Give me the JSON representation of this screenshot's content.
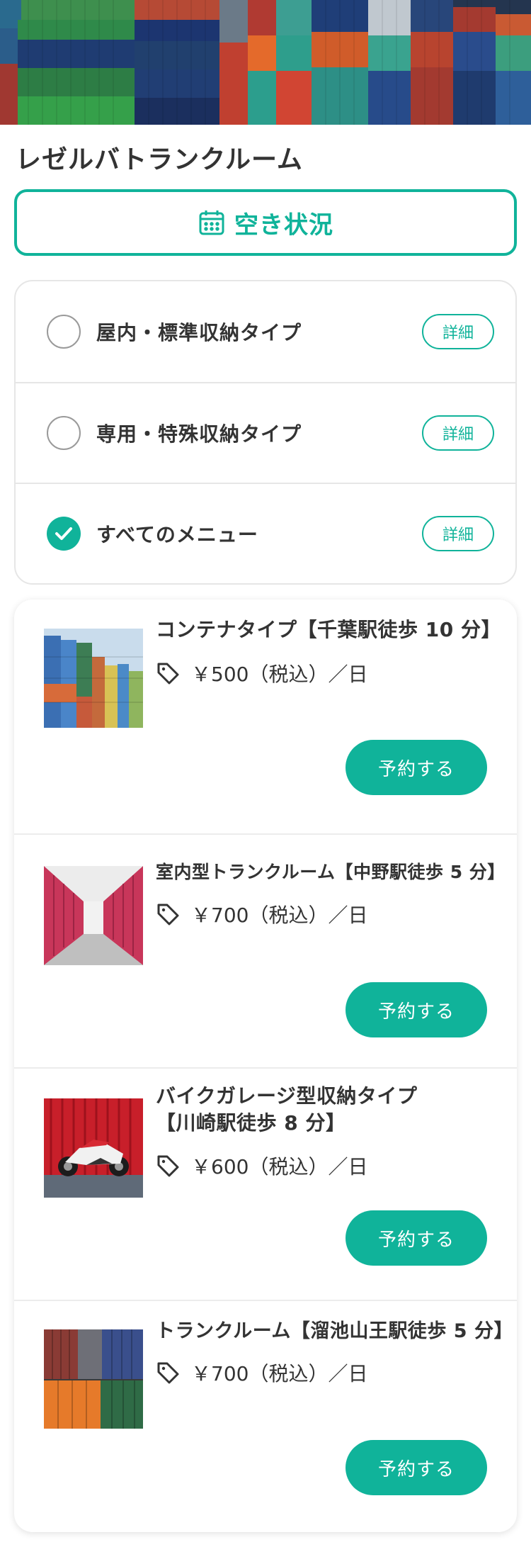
{
  "page": {
    "title": "レゼルバトランクルーム",
    "availability_button": "空き状況"
  },
  "filters": [
    {
      "label": "屋内・標準収納タイプ",
      "detail": "詳細",
      "checked": false
    },
    {
      "label": "専用・特殊収納タイプ",
      "detail": "詳細",
      "checked": false
    },
    {
      "label": "すべてのメニュー",
      "detail": "詳細",
      "checked": true
    }
  ],
  "listings": [
    {
      "title": "コンテナタイプ【千葉駅徒歩 10 分】",
      "price": "￥500（税込）／日",
      "button": "予約する",
      "image": "stacked-containers-photo"
    },
    {
      "title": "室内型トランクルーム【中野駅徒歩 5 分】",
      "price": "￥700（税込）／日",
      "button": "予約する",
      "image": "indoor-storage-corridor-photo"
    },
    {
      "title_line1": "バイクガレージ型収納タイプ",
      "title_line2": "【川崎駅徒歩 8 分】",
      "price": "￥600（税込）／日",
      "button": "予約する",
      "image": "motorcycle-garage-photo"
    },
    {
      "title": "トランクルーム【溜池山王駅徒歩 5 分】",
      "price": "￥700（税込）／日",
      "button": "予約する",
      "image": "container-doors-photo"
    }
  ],
  "colors": {
    "accent": "#10b39a",
    "text": "#333333",
    "border": "#e6e6e6"
  },
  "icons": {
    "availability": "calendar-icon",
    "price": "price-tag-icon",
    "checked": "check-icon"
  }
}
